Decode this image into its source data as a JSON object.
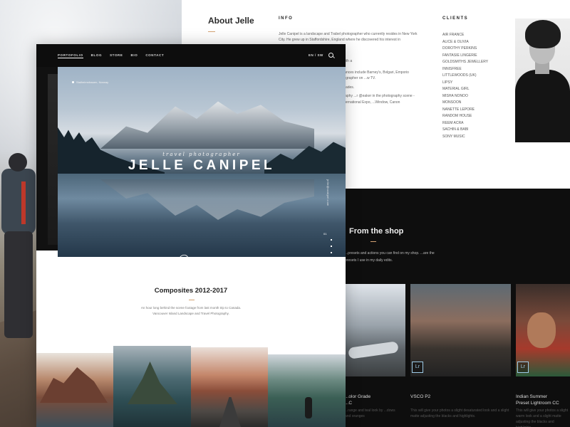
{
  "about": {
    "title": "About Jelle",
    "info_heading": "INFO",
    "info_paragraphs": [
      "Jelle Canipel is a landscape and Trabel photographer who currently resides in New York City. He grew up in Staffordshire, England where he discovered his interest in photography",
      "...th, unique beauty and timeless style.",
      "...elegance, Jelle enjoys creating stories with a",
      "...has led to several TV and digital appearances include Barney's, Bvlgari, Emporio Armani, also been featured as guest photographer on ...w TV.",
      "...ave a number of sponsorships and accolades.",
      "...e also tutors fashion amid travel photography ...r @eaker in the photography scene - @peaking ...R. Photo Show, PhotoPlus International Expo, ...Window, Canon Professional Network, Shotkit."
    ],
    "clients_heading": "CLIENTS",
    "clients": [
      "AIR FRANCE",
      "ALICE & OLIVIA",
      "DOROTHY PERKINS",
      "FANTASIE LINGERIE",
      "GOLDSMITHS JEWELLERY",
      "INNISFREE",
      "LITTLEWOODS (UK)",
      "LIPSY",
      "MATERIAL GIRL",
      "MISHA NONOO",
      "MONSOON",
      "NANETTE LEPORE",
      "RANDOM HOUSE",
      "REEM ACRA",
      "SACHIN & BABI",
      "SONY MUSIC"
    ]
  },
  "shop": {
    "title": "From the shop",
    "description": "...presets and actions you can find on my shop. ...are the presets I use in my daily edits.",
    "products": [
      {
        "name": "...olor Grade",
        "name2": "...C",
        "desc": "...range and teal look by ...dows and oranges",
        "badge": ""
      },
      {
        "name": "VSCO P2",
        "name2": "",
        "desc": "This will give your photos a slight desaturated look and a slight matte adjusting the blacks and highlights.",
        "badge": "Lr"
      },
      {
        "name": "Indian Summer",
        "name2": "Preset Lightroom CC",
        "desc": "This will give your photos a slight warm look and a slight matte adjusting the blacks and highlights.",
        "badge": "Lr"
      }
    ]
  },
  "landing": {
    "nav": [
      "PORTOFOLIO",
      "BLOG",
      "STORE",
      "BIO",
      "CONTACT"
    ],
    "lang": "EN  /  SW",
    "location": "Stalheimsfossen, Norway",
    "hero_subtitle": "travel photographer",
    "hero_title": "JELLE CANIPEL",
    "vertical_text": "jelle@canipel.com",
    "slide_number": "01",
    "social": [
      "ig",
      "f",
      "tw"
    ],
    "signature": "Canipel",
    "composites_title": "Composites 2012-2017",
    "composites_desc": "An hour long behind the scene footage from last month trip to Canada. Vancouver Island Landscape and Travel Photography."
  },
  "colors": {
    "accent": "#d4a373",
    "dark": "#0e0e0e"
  }
}
